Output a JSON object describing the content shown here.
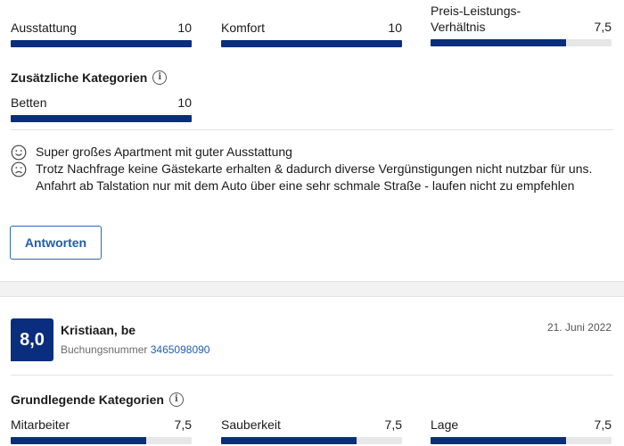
{
  "top_metrics": [
    {
      "label": "Ausstattung",
      "score": "10",
      "fraction": 1.0
    },
    {
      "label": "Komfort",
      "score": "10",
      "fraction": 1.0
    },
    {
      "label": "Preis-Leistungs-\nVerhältnis",
      "score": "7,5",
      "fraction": 0.75
    }
  ],
  "additional": {
    "title": "Zusätzliche Kategorien",
    "items": [
      {
        "label": "Betten",
        "score": "10",
        "fraction": 1.0
      }
    ]
  },
  "review1": {
    "positive": "Super großes Apartment mit guter Ausstattung",
    "negative": "Trotz Nachfrage keine Gästekarte erhalten & dadurch diverse Vergünstigungen nicht nutzbar für uns. Anfahrt ab Talstation nur mit dem Auto über eine sehr schmale Straße - laufen nicht zu empfehlen",
    "reply_label": "Antworten"
  },
  "review2": {
    "score": "8,0",
    "reviewer": "Kristiaan, be",
    "booking_label": "Buchungsnummer",
    "booking_number": "3465098090",
    "date": "21. Juni 2022",
    "basic_title": "Grundlegende Kategorien",
    "metrics": [
      {
        "label": "Mitarbeiter",
        "score": "7,5",
        "fraction": 0.75
      },
      {
        "label": "Sauberkeit",
        "score": "7,5",
        "fraction": 0.75
      },
      {
        "label": "Lage",
        "score": "7,5",
        "fraction": 0.75
      }
    ]
  },
  "icons": {
    "info": "info-icon",
    "smile": "smile-icon",
    "frown": "frown-icon"
  },
  "colors": {
    "bar_fill": "#0a2e7d",
    "bar_track": "#e7e7e7",
    "link": "#1f5fae",
    "score_bg": "#0a2e7d"
  }
}
